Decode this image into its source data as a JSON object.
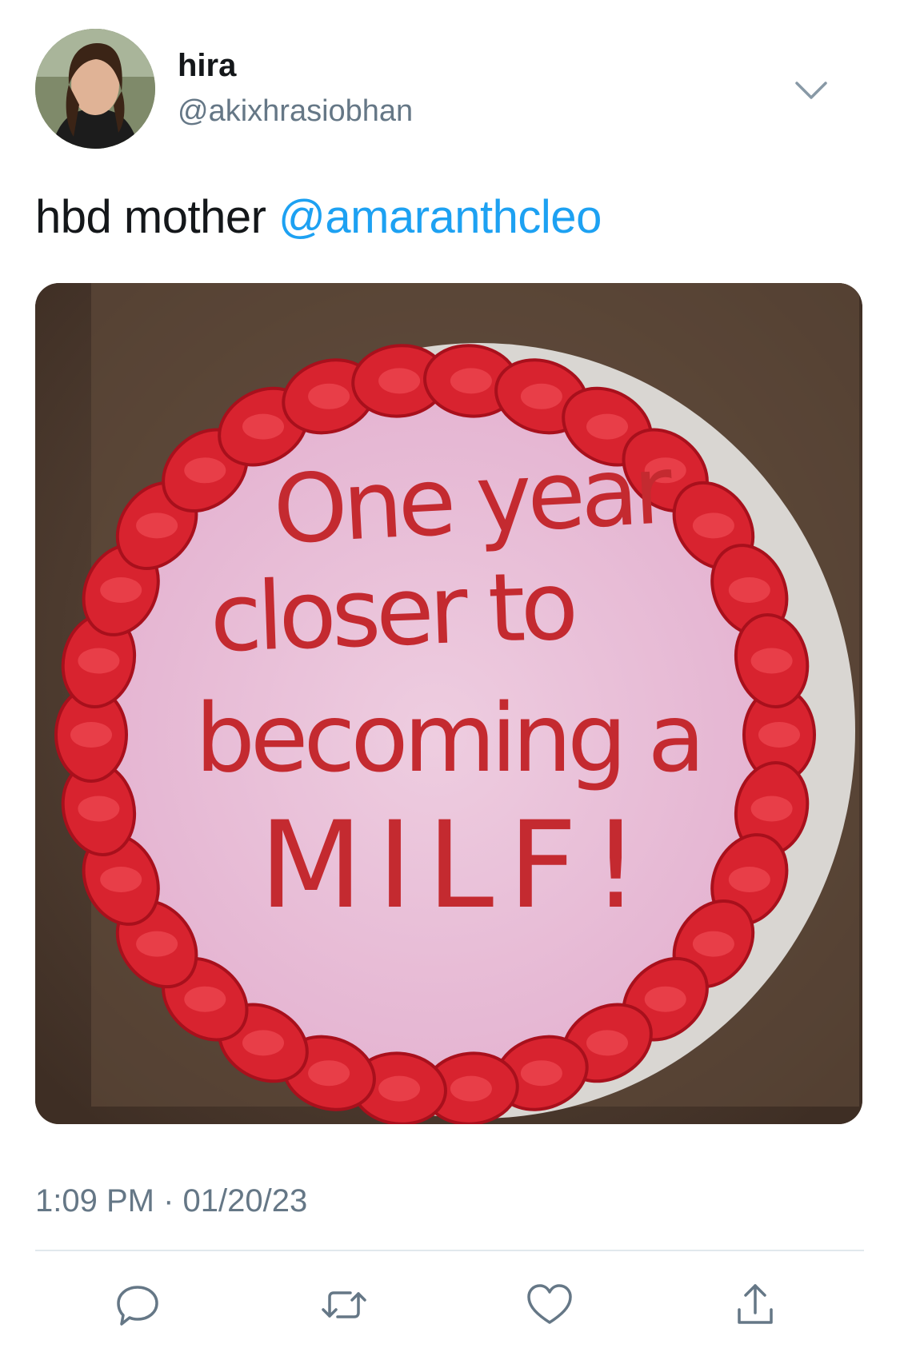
{
  "tweet": {
    "author": {
      "display_name": "hira",
      "handle": "@akixhrasiobhan",
      "avatar_icon": "profile-photo"
    },
    "text_prefix": "hbd mother ",
    "mention": "@amaranthcleo",
    "media": {
      "cake_lines": [
        "One year",
        "closer to",
        "becoming a",
        "MILF!"
      ]
    },
    "timestamp": "1:09 PM · 01/20/23",
    "actions": [
      {
        "name": "reply",
        "icon": "comment-icon"
      },
      {
        "name": "retweet",
        "icon": "retweet-icon"
      },
      {
        "name": "like",
        "icon": "heart-icon"
      },
      {
        "name": "share",
        "icon": "share-icon"
      }
    ]
  },
  "colors": {
    "link": "#1da1f2",
    "secondary_text": "#657786",
    "frosting_pink": "#e6b3d4",
    "piping_red": "#d8232f"
  }
}
